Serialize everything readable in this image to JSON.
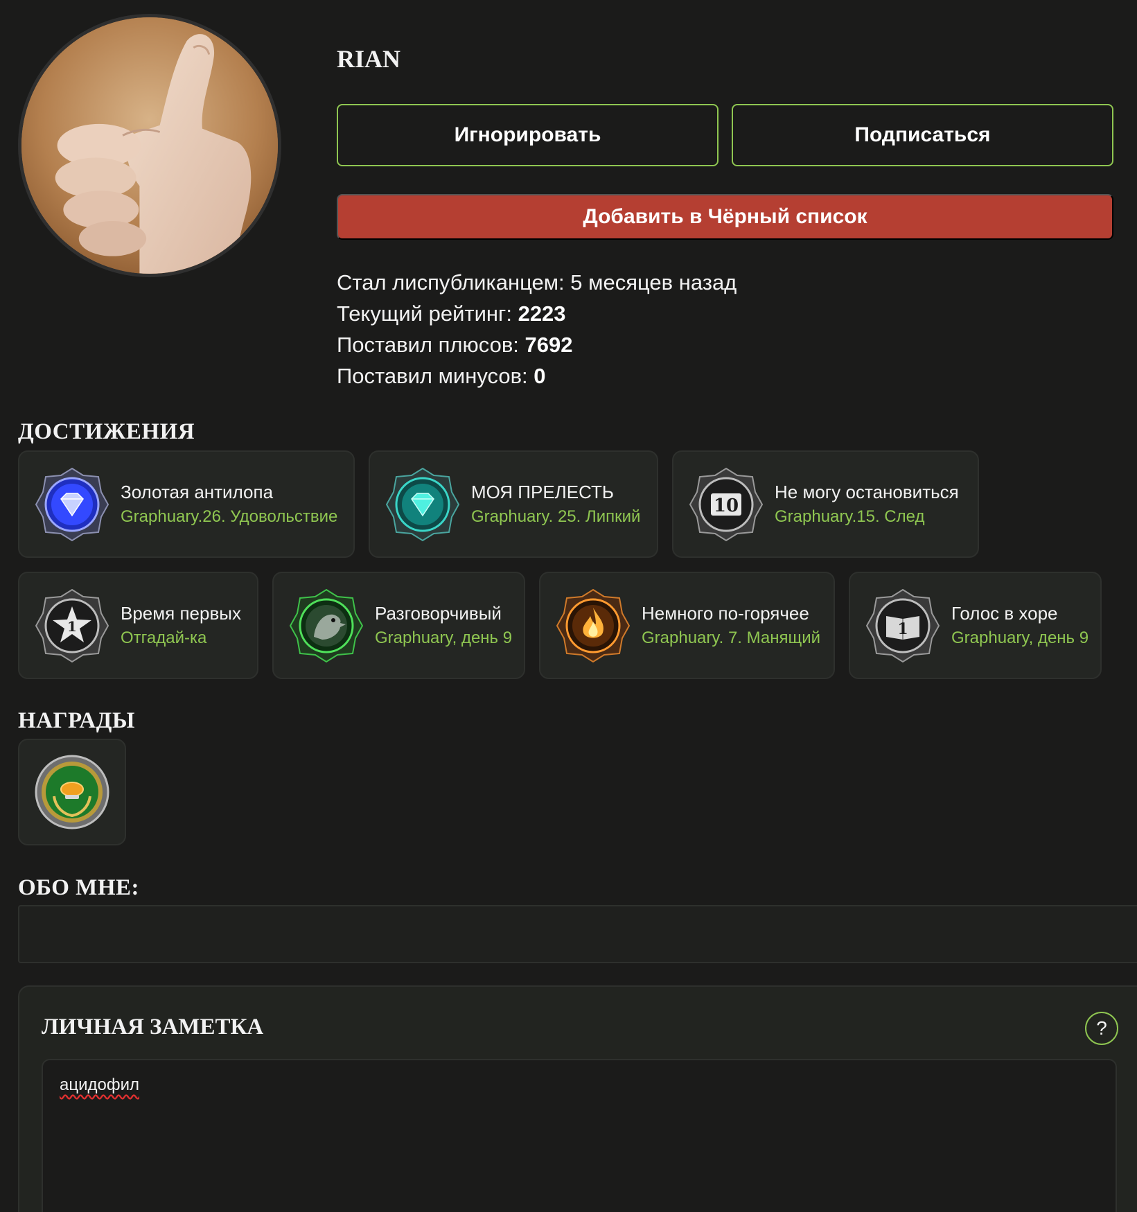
{
  "profile": {
    "username": "RIAN",
    "ignore_label": "Игнорировать",
    "subscribe_label": "Подписаться",
    "blacklist_label": "Добавить в Чёрный список"
  },
  "stats": {
    "joined_label": "Стал лиспубликанцем:",
    "joined_value": "5 месяцев назад",
    "rating_label": "Текущий рейтинг:",
    "rating_value": "2223",
    "pluses_label": "Поставил плюсов:",
    "pluses_value": "7692",
    "minuses_label": "Поставил минусов:",
    "minuses_value": "0"
  },
  "achievements_title": "ДОСТИЖЕНИЯ",
  "achievements": [
    {
      "name": "Золотая антилопа",
      "sub": "Graphuary.26. Удовольствие",
      "icon": "blue-diamond-badge-icon"
    },
    {
      "name": "МОЯ ПРЕЛЕСТЬ",
      "sub": "Graphuary. 25. Липкий",
      "icon": "teal-diamond-badge-icon"
    },
    {
      "name": "Не могу остановиться",
      "sub": "Graphuary.15. След",
      "icon": "number-10-badge-icon"
    },
    {
      "name": "Время первых",
      "sub": "Отгадай-ка",
      "icon": "star-1-badge-icon"
    },
    {
      "name": "Разговорчивый",
      "sub": "Graphuary, день 9",
      "icon": "green-bird-badge-icon"
    },
    {
      "name": "Немного по-горячее",
      "sub": "Graphuary. 7. Манящий",
      "icon": "flame-badge-icon"
    },
    {
      "name": "Голос в хоре",
      "sub": "Graphuary, день 9",
      "icon": "book-1-badge-icon"
    }
  ],
  "awards_title": "НАГРАДЫ",
  "awards": [
    {
      "icon": "laurel-medal-icon"
    }
  ],
  "about_title": "ОБО МНЕ:",
  "note": {
    "title": "ЛИЧНАЯ ЗАМЕТКА",
    "help_label": "?",
    "value": "ацидофил"
  },
  "colors": {
    "background": "#1b1b1a",
    "accent_green": "#8fc651",
    "danger_red": "#b53f32",
    "card_bg": "#242623"
  }
}
